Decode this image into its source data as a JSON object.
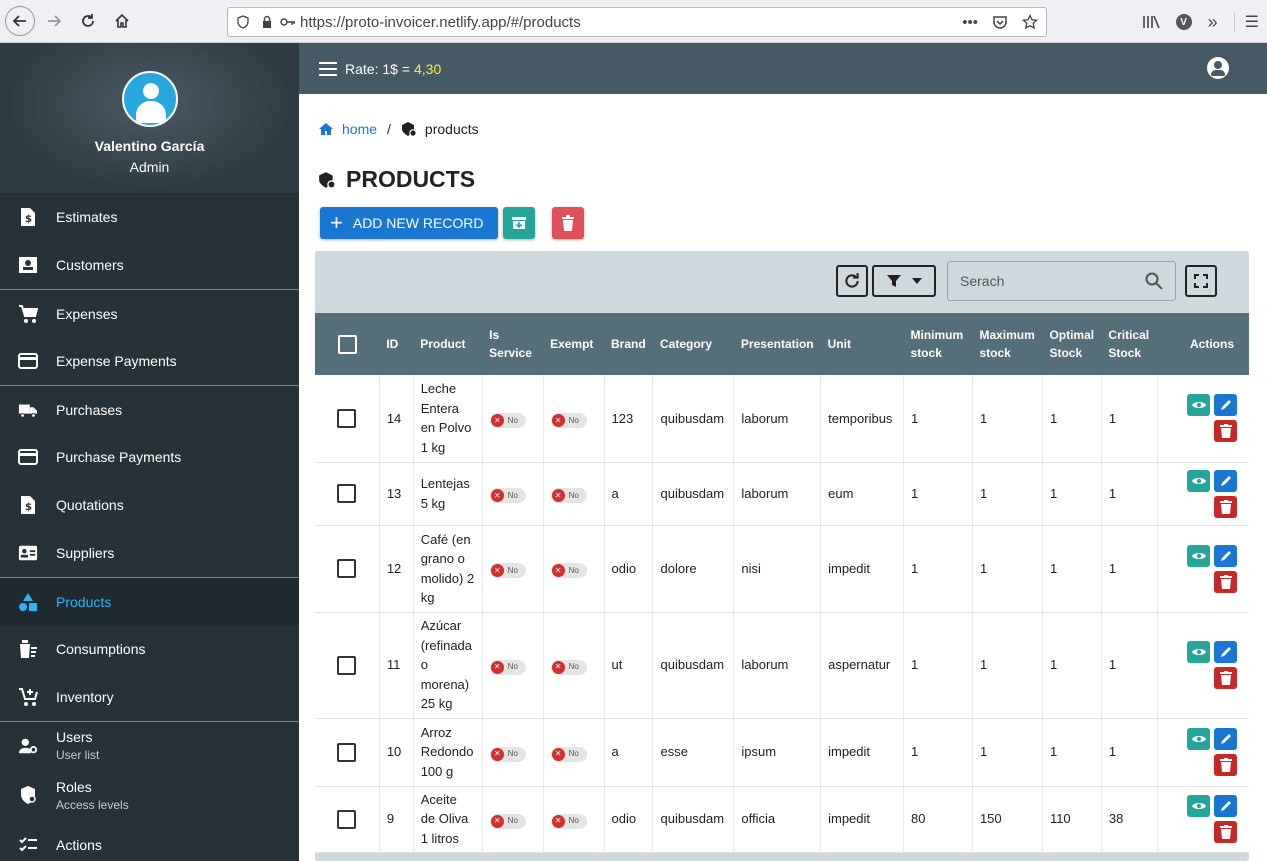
{
  "browser": {
    "url": "https://proto-invoicer.netlify.app/#/products"
  },
  "sidebar": {
    "user_name": "Valentino García",
    "user_role": "Admin",
    "items": [
      {
        "label": "Estimates",
        "icon": "estimate-icon"
      },
      {
        "label": "Customers",
        "icon": "contacts-icon"
      },
      {
        "label": "Expenses",
        "icon": "cart-icon"
      },
      {
        "label": "Expense Payments",
        "icon": "credit-card-icon"
      },
      {
        "label": "Purchases",
        "icon": "truck-icon"
      },
      {
        "label": "Purchase Payments",
        "icon": "credit-card-icon"
      },
      {
        "label": "Quotations",
        "icon": "quotation-icon"
      },
      {
        "label": "Suppliers",
        "icon": "contact-card-icon"
      },
      {
        "label": "Products",
        "icon": "shapes-icon"
      },
      {
        "label": "Consumptions",
        "icon": "consumption-icon"
      },
      {
        "label": "Inventory",
        "icon": "cart-plus-icon"
      },
      {
        "label": "Users",
        "sub": "User list",
        "icon": "user-cog-icon"
      },
      {
        "label": "Roles",
        "sub": "Access levels",
        "icon": "shield-icon"
      },
      {
        "label": "Actions",
        "sub": "",
        "icon": "checklist-icon"
      }
    ]
  },
  "topbar": {
    "rate_label": "Rate: 1$ =",
    "rate_value": "4,30"
  },
  "breadcrumb": {
    "home": "home",
    "separator": "/",
    "current": "products"
  },
  "page": {
    "title": "PRODUCTS",
    "add_button": "ADD NEW RECORD",
    "search_placeholder": "Serach"
  },
  "table": {
    "headers": [
      "ID",
      "Product",
      "Is Service",
      "Exempt",
      "Brand",
      "Category",
      "Presentation",
      "Unit",
      "Minimum stock",
      "Maximum stock",
      "Optimal Stock",
      "Critical Stock",
      "Actions"
    ],
    "chip_no": "No",
    "rows": [
      {
        "id": "14",
        "product": "Leche Entera en Polvo 1 kg",
        "brand": "123",
        "category": "quibusdam",
        "presentation": "laborum",
        "unit": "temporibus",
        "min": "1",
        "max": "1",
        "opt": "1",
        "crit": "1"
      },
      {
        "id": "13",
        "product": "Lentejas 5 kg",
        "brand": "a",
        "category": "quibusdam",
        "presentation": "laborum",
        "unit": "eum",
        "min": "1",
        "max": "1",
        "opt": "1",
        "crit": "1"
      },
      {
        "id": "12",
        "product": "Café (en grano o molido) 2 kg",
        "brand": "odio",
        "category": "dolore",
        "presentation": "nisi",
        "unit": "impedit",
        "min": "1",
        "max": "1",
        "opt": "1",
        "crit": "1"
      },
      {
        "id": "11",
        "product": "Azúcar (refinada o morena) 25 kg",
        "brand": "ut",
        "category": "quibusdam",
        "presentation": "laborum",
        "unit": "aspernatur",
        "min": "1",
        "max": "1",
        "opt": "1",
        "crit": "1"
      },
      {
        "id": "10",
        "product": "Arroz Redondo 100 g",
        "brand": "a",
        "category": "esse",
        "presentation": "ipsum",
        "unit": "impedit",
        "min": "1",
        "max": "1",
        "opt": "1",
        "crit": "1"
      },
      {
        "id": "9",
        "product": "Aceite de Oliva 1 litros",
        "brand": "odio",
        "category": "quibusdam",
        "presentation": "officia",
        "unit": "impedit",
        "min": "80",
        "max": "150",
        "opt": "110",
        "crit": "38"
      }
    ]
  },
  "colors": {
    "sidebar_bg": "#263238",
    "topbar_bg": "#455a64",
    "table_header_bg": "#546e7a",
    "primary": "#1976d2",
    "teal": "#26a69a",
    "danger": "#c62828",
    "active_menu": "#29b6f6",
    "rate_highlight": "#ffeb3b"
  }
}
